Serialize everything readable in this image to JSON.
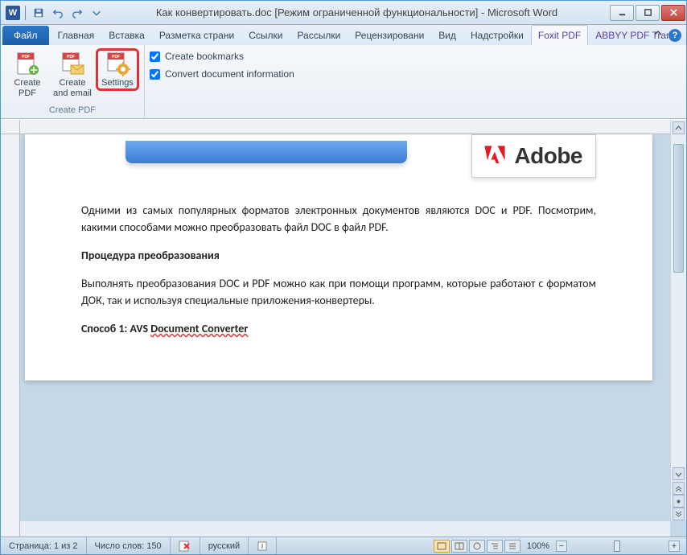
{
  "window": {
    "title": "Как конвертировать.doc [Режим ограниченной функциональности] - Microsoft Word"
  },
  "qat": {
    "save": "save",
    "undo": "undo",
    "redo": "redo"
  },
  "tabs": {
    "file": "Файл",
    "items": [
      "Главная",
      "Вставка",
      "Разметка страни",
      "Ссылки",
      "Рассылки",
      "Рецензировани",
      "Вид",
      "Надстройки",
      "Foxit PDF",
      "ABBYY PDF Trans"
    ],
    "activeIndex": 8
  },
  "ribbon": {
    "group_label": "Create PDF",
    "btn_create_pdf": "Create\nPDF",
    "btn_create_email": "Create\nand email",
    "btn_settings": "Settings",
    "chk_bookmarks": "Create bookmarks",
    "chk_docinfo": "Convert document information"
  },
  "document": {
    "adobe": "Adobe",
    "p1": "Одними из самых популярных форматов электронных документов являются DOC и PDF. Посмотрим, какими способами можно преобразовать файл DOC в файл PDF.",
    "p2": "Процедура преобразования",
    "p3": "Выполнять преобразования DOC и PDF можно как при помощи программ, которые работают с форматом ДОК, так и используя специальные приложения-конвертеры.",
    "p4_prefix": "Способ 1: AVS ",
    "p4_underline": "Document Converter"
  },
  "status": {
    "page": "Страница: 1 из 2",
    "words": "Число слов: 150",
    "lang": "русский",
    "zoom": "100%"
  }
}
